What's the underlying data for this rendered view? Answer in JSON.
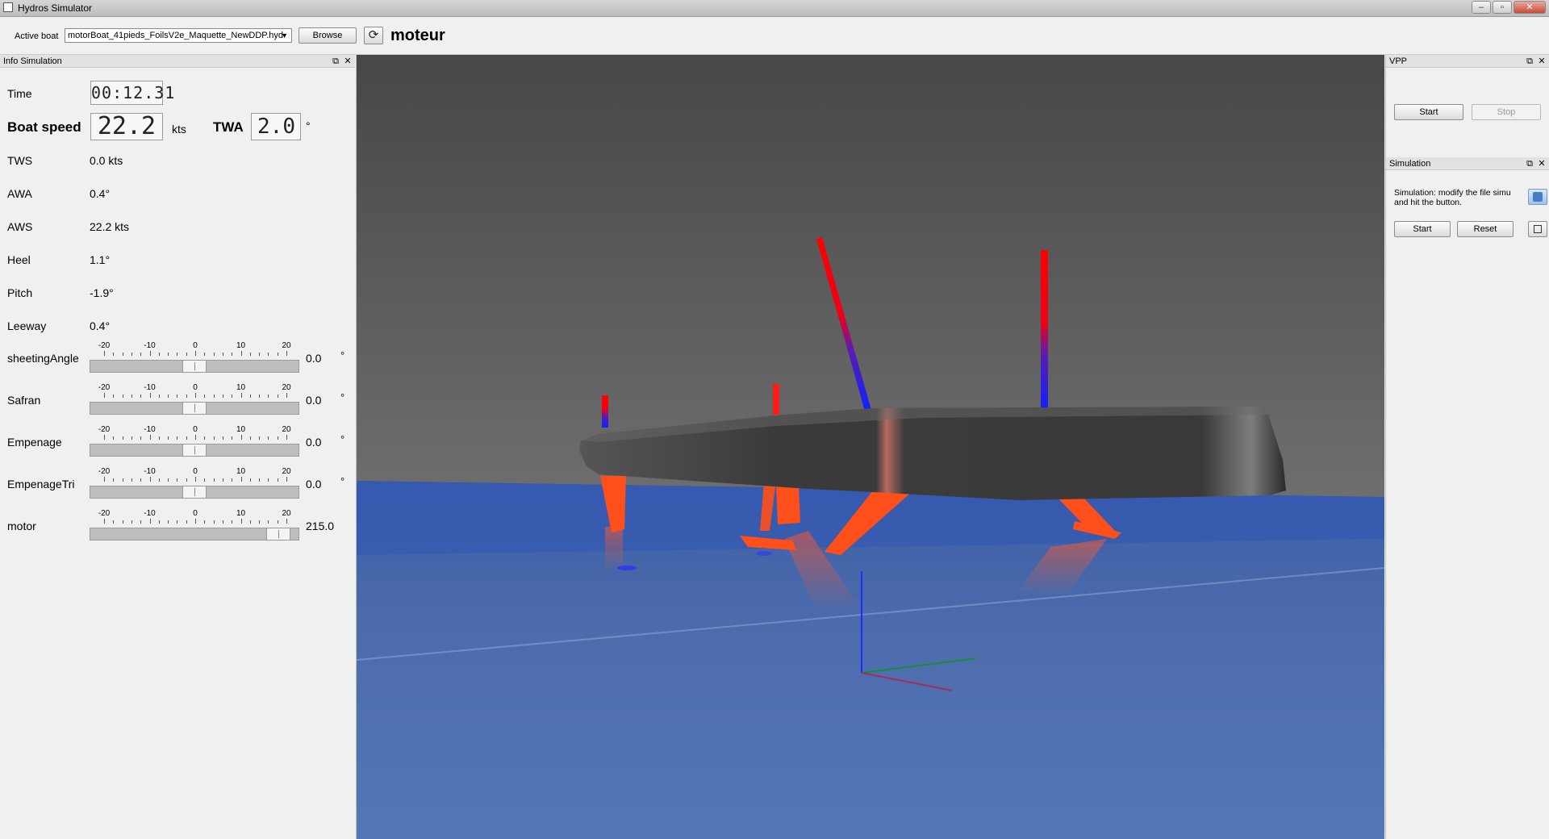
{
  "window": {
    "title": "Hydros Simulator"
  },
  "toolbar": {
    "active_boat_label": "Active boat",
    "active_boat_value": "motorBoat_41pieds_FoilsV2e_Maquette_NewDDP.hyd",
    "browse_label": "Browse",
    "mode_title": "moteur"
  },
  "info_panel": {
    "title": "Info Simulation",
    "time_label": "Time",
    "time_value": "00:12.31",
    "boat_speed_label": "Boat speed",
    "boat_speed_value": "22.2",
    "boat_speed_unit": "kts",
    "twa_label": "TWA",
    "twa_value": "2.0",
    "twa_unit": "°",
    "rows": [
      {
        "label": "TWS",
        "value": "0.0 kts"
      },
      {
        "label": "AWA",
        "value": "0.4°"
      },
      {
        "label": "AWS",
        "value": "22.2 kts"
      },
      {
        "label": "Heel",
        "value": "1.1°"
      },
      {
        "label": "Pitch",
        "value": "-1.9°"
      },
      {
        "label": "Leeway",
        "value": "0.4°"
      }
    ],
    "slider_ticks": [
      "-20",
      "-10",
      "0",
      "10",
      "20"
    ],
    "sliders": [
      {
        "label": "sheetingAngle",
        "value": "0.0",
        "unit": "°",
        "position": 0.5
      },
      {
        "label": "Safran",
        "value": "0.0",
        "unit": "°",
        "position": 0.5
      },
      {
        "label": "Empenage",
        "value": "0.0",
        "unit": "°",
        "position": 0.5
      },
      {
        "label": "EmpenageTri",
        "value": "0.0",
        "unit": "°",
        "position": 0.5
      },
      {
        "label": "motor",
        "value": "215.0",
        "unit": "",
        "position": 0.95
      }
    ]
  },
  "vpp_panel": {
    "title": "VPP",
    "start_label": "Start",
    "stop_label": "Stop"
  },
  "simulation_panel": {
    "title": "Simulation",
    "note": "Simulation: modify the file simu and hit the button.",
    "start_label": "Start",
    "reset_label": "Reset"
  },
  "colors": {
    "hull": "#3f3f3f",
    "foils": "#ff4f1a",
    "water": "#4a6fb5",
    "sky_top": "#4a4a4a",
    "sky_bottom": "#8a8a8a"
  }
}
